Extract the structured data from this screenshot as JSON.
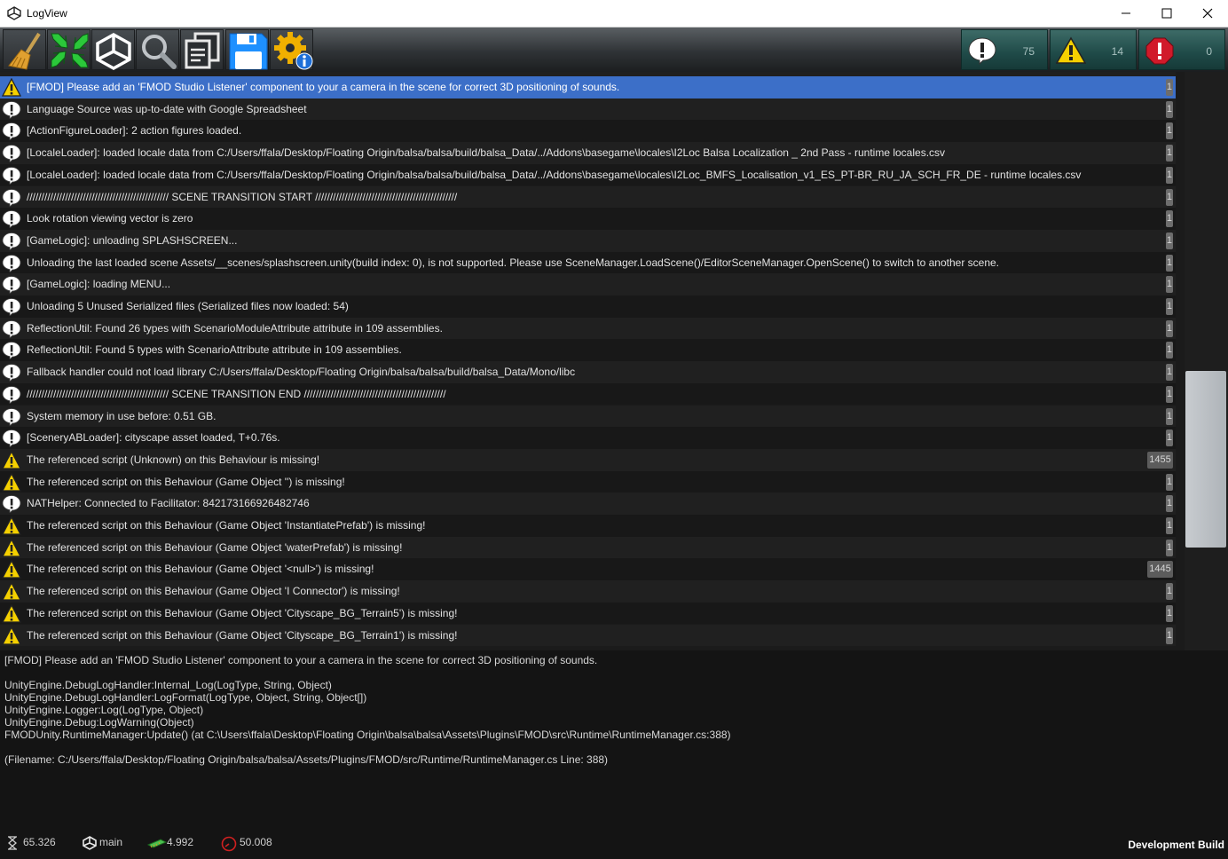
{
  "window": {
    "title": "LogView"
  },
  "toolbar": {
    "buttons": [
      {
        "name": "clear-button",
        "icon": "broom-icon"
      },
      {
        "name": "collapse-button",
        "icon": "collapse-arrows-icon"
      },
      {
        "name": "unity-button",
        "icon": "unity-logo-icon"
      },
      {
        "name": "search-button",
        "icon": "magnifier-icon"
      },
      {
        "name": "copy-button",
        "icon": "copy-icon"
      },
      {
        "name": "save-button",
        "icon": "floppy-disk-icon"
      },
      {
        "name": "settings-button",
        "icon": "gear-info-icon"
      }
    ],
    "counters": {
      "info": "75",
      "warning": "14",
      "error": "0"
    }
  },
  "log": {
    "rows": [
      {
        "type": "warning",
        "text": "[FMOD] Please add an 'FMOD Studio Listener' component to your a camera in the scene for correct 3D positioning of sounds.",
        "count": "1",
        "selected": true
      },
      {
        "type": "info",
        "text": "Language Source was up-to-date with Google Spreadsheet",
        "count": "1"
      },
      {
        "type": "info",
        "text": "[ActionFigureLoader]: 2 action figures loaded.",
        "count": "1"
      },
      {
        "type": "info",
        "text": "[LocaleLoader]: loaded locale data from C:/Users/ffala/Desktop/Floating Origin/balsa/balsa/build/balsa_Data/../Addons\\basegame\\locales\\I2Loc Balsa Localization _ 2nd Pass - runtime locales.csv",
        "count": "1"
      },
      {
        "type": "info",
        "text": "[LocaleLoader]: loaded locale data from C:/Users/ffala/Desktop/Floating Origin/balsa/balsa/build/balsa_Data/../Addons\\basegame\\locales\\I2Loc_BMFS_Localisation_v1_ES_PT-BR_RU_JA_SCH_FR_DE - runtime locales.csv",
        "count": "1"
      },
      {
        "type": "info",
        "text": "//////////////////////////////////////////////// SCENE TRANSITION START  ////////////////////////////////////////////////",
        "count": "1"
      },
      {
        "type": "info",
        "text": "Look rotation viewing vector is zero",
        "count": "1"
      },
      {
        "type": "info",
        "text": "[GameLogic]: unloading SPLASHSCREEN...",
        "count": "1"
      },
      {
        "type": "info",
        "text": "Unloading the last loaded scene Assets/__scenes/splashscreen.unity(build index: 0), is not supported. Please use SceneManager.LoadScene()/EditorSceneManager.OpenScene() to switch to another scene.",
        "count": "1"
      },
      {
        "type": "info",
        "text": "[GameLogic]: loading MENU...",
        "count": "1"
      },
      {
        "type": "info",
        "text": "Unloading 5 Unused Serialized files (Serialized files now loaded: 54)",
        "count": "1"
      },
      {
        "type": "info",
        "text": "ReflectionUtil: Found 26 types with ScenarioModuleAttribute attribute in 109 assemblies.",
        "count": "1"
      },
      {
        "type": "info",
        "text": "ReflectionUtil: Found 5 types with ScenarioAttribute attribute in 109 assemblies.",
        "count": "1"
      },
      {
        "type": "info",
        "text": "Fallback handler could not load library C:/Users/ffala/Desktop/Floating Origin/balsa/balsa/build/balsa_Data/Mono/libc",
        "count": "1"
      },
      {
        "type": "info",
        "text": "//////////////////////////////////////////////// SCENE TRANSITION END  ////////////////////////////////////////////////",
        "count": "1"
      },
      {
        "type": "info",
        "text": "System memory in use before: 0.51 GB.",
        "count": "1"
      },
      {
        "type": "info",
        "text": "[SceneryABLoader]: cityscape asset loaded, T+0.76s.",
        "count": "1"
      },
      {
        "type": "warning",
        "text": "The referenced script (Unknown) on this Behaviour is missing!",
        "count": "1455"
      },
      {
        "type": "warning",
        "text": "The referenced script on this Behaviour (Game Object '') is missing!",
        "count": "1"
      },
      {
        "type": "info",
        "text": "NATHelper: Connected to Facilitator: 842173166926482746",
        "count": "1"
      },
      {
        "type": "warning",
        "text": "The referenced script on this Behaviour (Game Object 'InstantiatePrefab') is missing!",
        "count": "1"
      },
      {
        "type": "warning",
        "text": "The referenced script on this Behaviour (Game Object 'waterPrefab') is missing!",
        "count": "1"
      },
      {
        "type": "warning",
        "text": "The referenced script on this Behaviour (Game Object '<null>') is missing!",
        "count": "1445"
      },
      {
        "type": "warning",
        "text": "The referenced script on this Behaviour (Game Object 'I Connector') is missing!",
        "count": "1"
      },
      {
        "type": "warning",
        "text": "The referenced script on this Behaviour (Game Object 'Cityscape_BG_Terrain5') is missing!",
        "count": "1"
      },
      {
        "type": "warning",
        "text": "The referenced script on this Behaviour (Game Object 'Cityscape_BG_Terrain1') is missing!",
        "count": "1"
      }
    ]
  },
  "detail": {
    "lines": [
      "[FMOD] Please add an 'FMOD Studio Listener' component to your a camera in the scene for correct 3D positioning of sounds.",
      "",
      "UnityEngine.DebugLogHandler:Internal_Log(LogType, String, Object)",
      "UnityEngine.DebugLogHandler:LogFormat(LogType, Object, String, Object[])",
      "UnityEngine.Logger:Log(LogType, Object)",
      "UnityEngine.Debug:LogWarning(Object)",
      "FMODUnity.RuntimeManager:Update() (at C:\\Users\\ffala\\Desktop\\Floating Origin\\balsa\\balsa\\Assets\\Plugins\\FMOD\\src\\Runtime\\RuntimeManager.cs:388)",
      "",
      "(Filename: C:/Users/ffala/Desktop/Floating Origin/balsa/balsa/Assets/Plugins/FMOD/src/Runtime/RuntimeManager.cs Line: 388)"
    ]
  },
  "status": {
    "time": "65.326",
    "thread": "main",
    "memory": "4.992",
    "fps": "50.008",
    "build": "Development Build"
  },
  "colors": {
    "selected_row": "#3c6fc8",
    "warning": "#f5d000",
    "error": "#d11a2a",
    "info": "#ffffff",
    "counter_bg": "#1f4a48"
  }
}
